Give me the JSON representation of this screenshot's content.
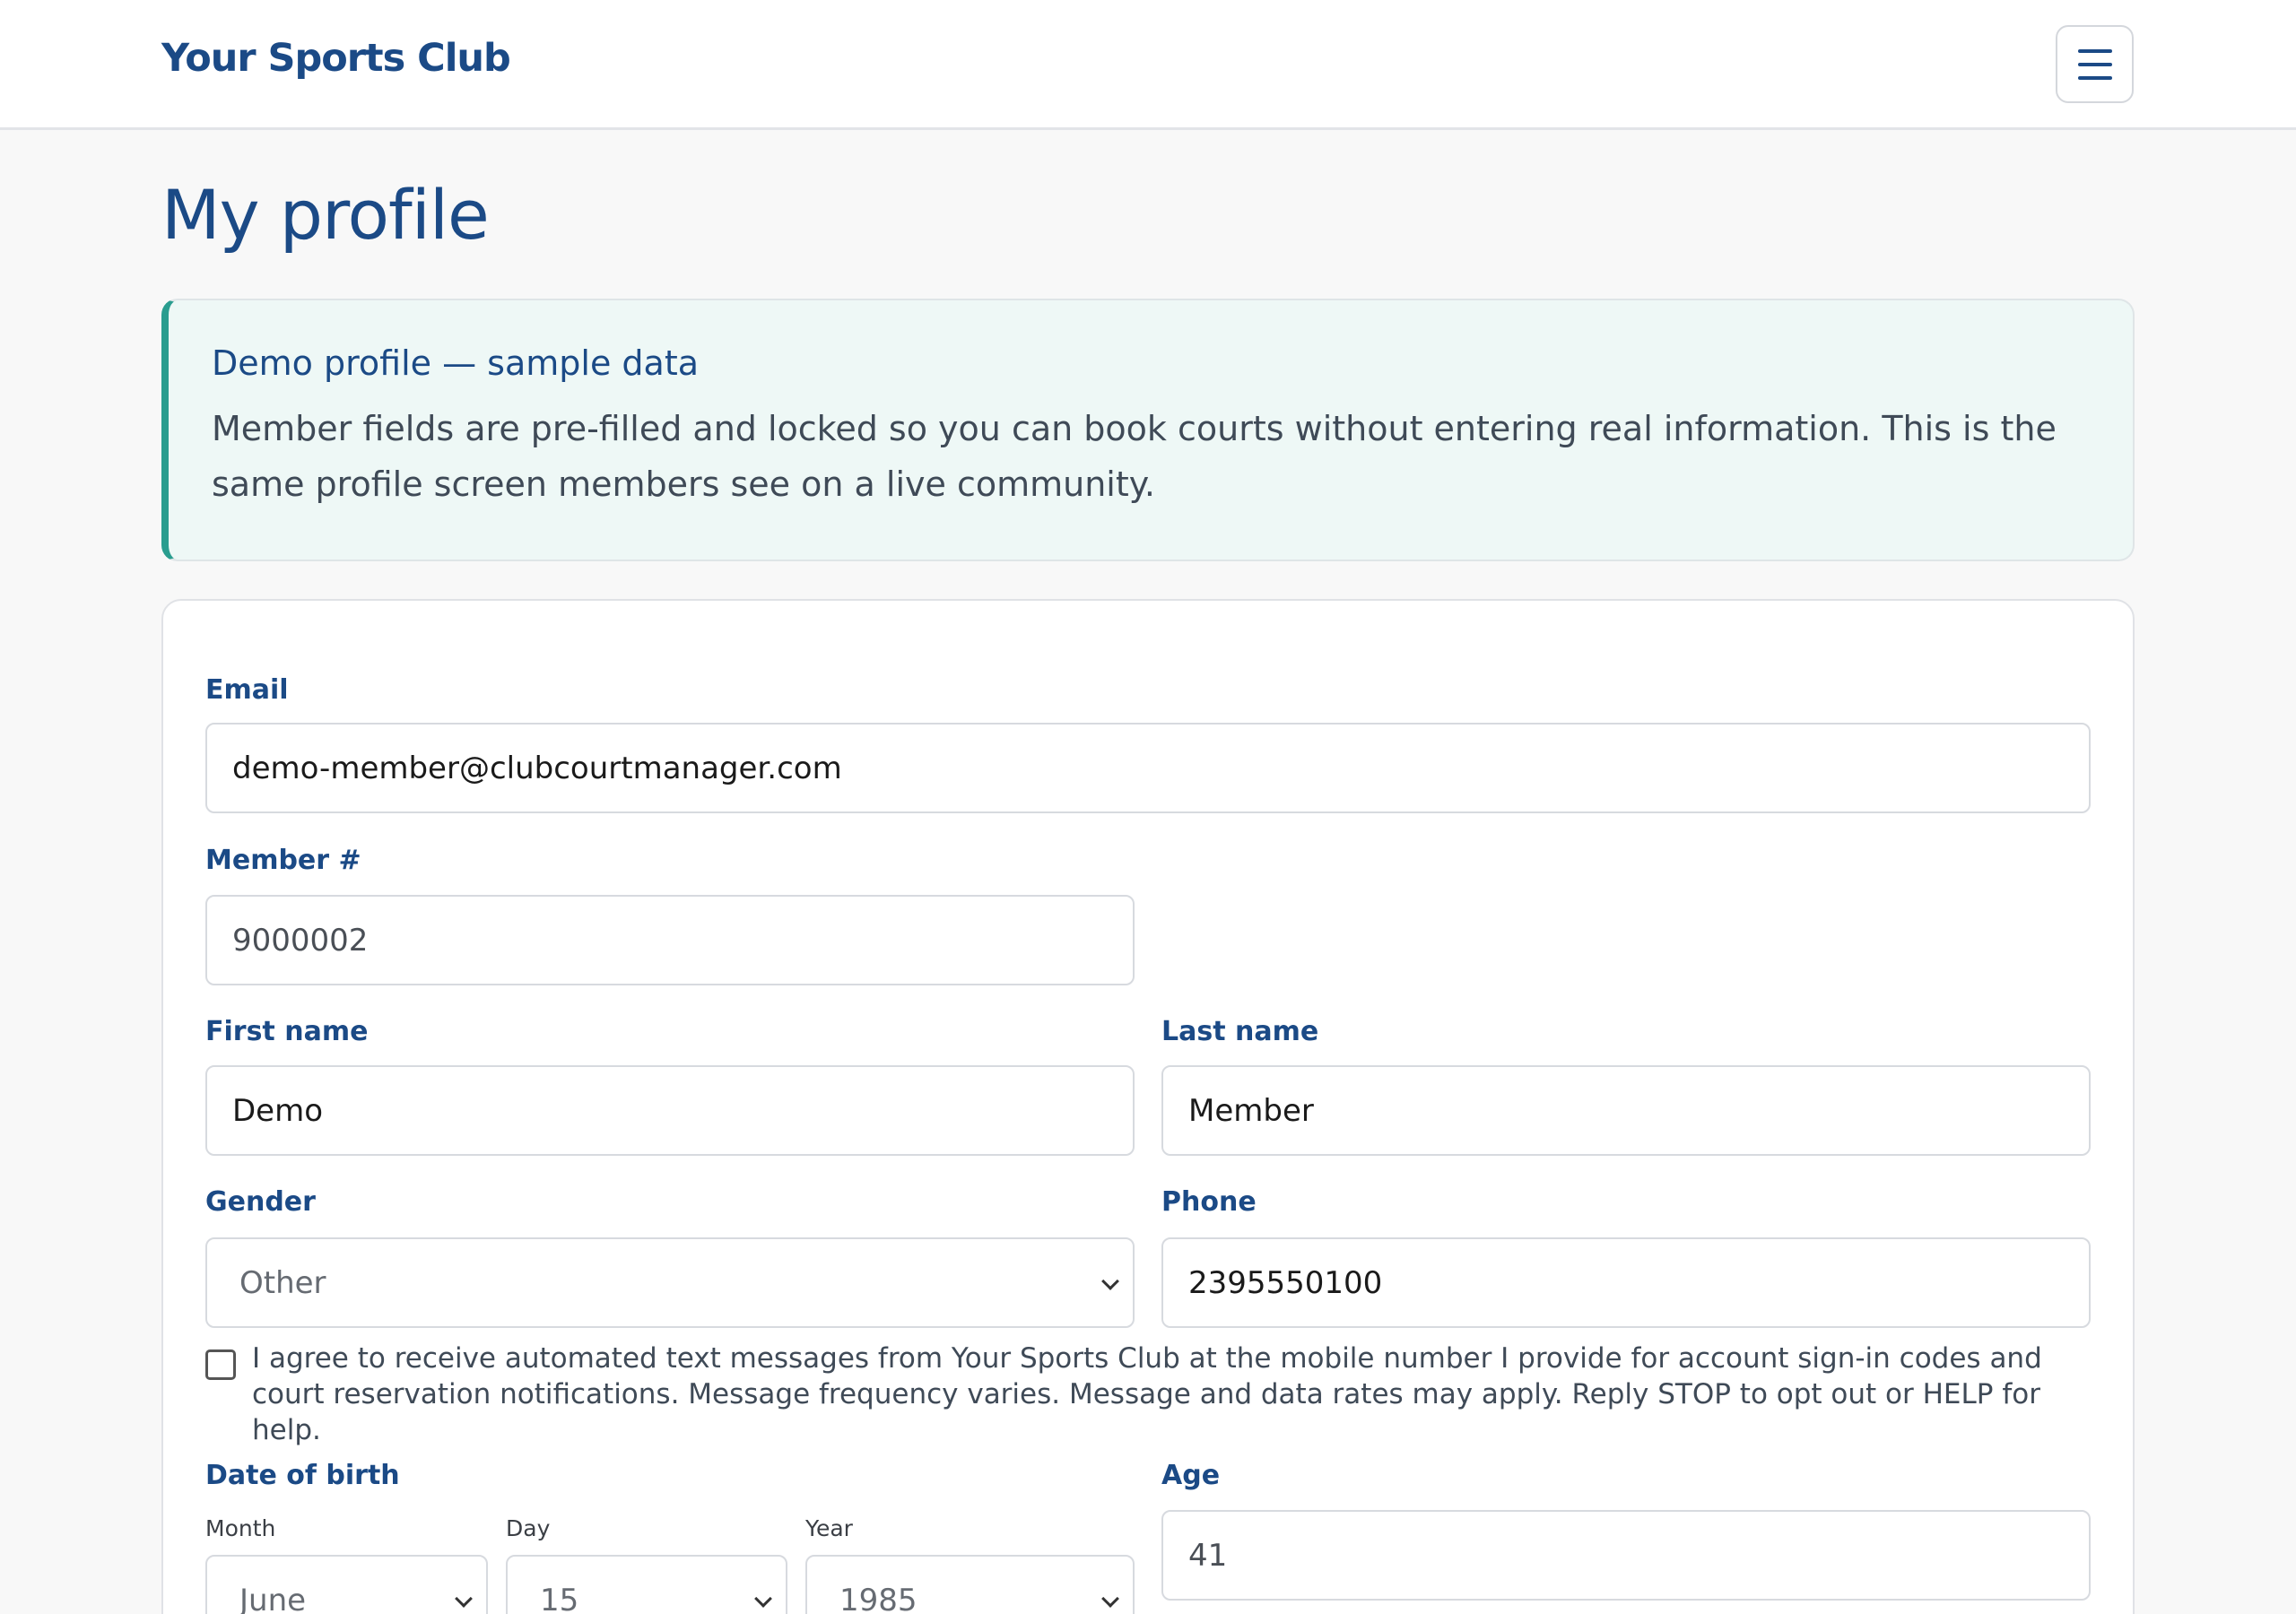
{
  "header": {
    "brand": "Your Sports Club",
    "menu_icon": "hamburger-menu-icon"
  },
  "page": {
    "title": "My profile"
  },
  "notice": {
    "title": "Demo profile — sample data",
    "body": "Member fields are pre-filled and locked so you can book courts without entering real information. This is the same profile screen members see on a live community."
  },
  "form": {
    "email": {
      "label": "Email",
      "value": "demo-member@clubcourtmanager.com"
    },
    "member_number": {
      "label": "Member #",
      "value": "9000002"
    },
    "first_name": {
      "label": "First name",
      "value": "Demo"
    },
    "last_name": {
      "label": "Last name",
      "value": "Member"
    },
    "gender": {
      "label": "Gender",
      "value": "Other"
    },
    "phone": {
      "label": "Phone",
      "value": "2395550100"
    },
    "sms_consent": {
      "checked": false,
      "text": "I agree to receive automated text messages from Your Sports Club at the mobile number I provide for account sign-in codes and court reservation notifications. Message frequency varies. Message and data rates may apply. Reply STOP to opt out or HELP for help."
    },
    "dob": {
      "label": "Date of birth",
      "month": {
        "label": "Month",
        "value": "June"
      },
      "day": {
        "label": "Day",
        "value": "15"
      },
      "year": {
        "label": "Year",
        "value": "1985"
      }
    },
    "age": {
      "label": "Age",
      "value": "41"
    }
  },
  "colors": {
    "brand": "#1b4a86",
    "accent": "#2a9d8f",
    "notice_bg": "#eef8f6"
  }
}
